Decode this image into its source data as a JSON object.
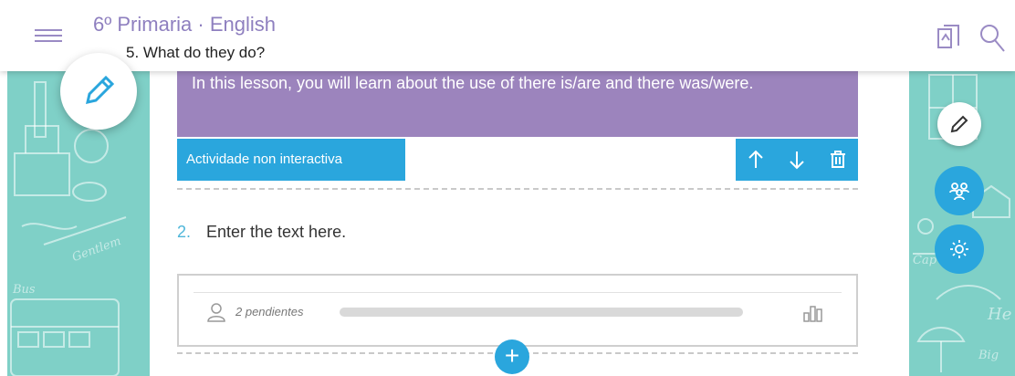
{
  "header": {
    "course_title": "6º Primaria · English",
    "unit_title": "5. What do they do?"
  },
  "lesson": {
    "intro_text": "In this lesson, you will learn about the use of there is/are and there was/were.",
    "activity_tag": "Actividade non interactiva",
    "question_number": "2.",
    "question_text": "Enter the text here."
  },
  "stats": {
    "pending_label": "2 pendientes",
    "progress_fraction": 0
  },
  "decor": {
    "left_words": [
      "Gentlem",
      "Bus"
    ],
    "right_words": [
      "Cap",
      "He",
      "Big"
    ]
  },
  "colors": {
    "accent_blue": "#2aa6dd",
    "lesson_purple": "#9c84bd",
    "header_purple": "#8e7fbf",
    "pattern_teal": "#7fd0c7"
  },
  "icons": {
    "menu": "hamburger-icon",
    "book": "book-icon",
    "search": "search-icon",
    "edit": "pencil-icon",
    "move_up": "arrow-up-icon",
    "move_down": "arrow-down-icon",
    "delete": "trash-icon",
    "groups": "group-icon",
    "settings": "gear-icon",
    "add": "plus-icon",
    "user": "person-icon",
    "stats": "bar-chart-icon"
  }
}
